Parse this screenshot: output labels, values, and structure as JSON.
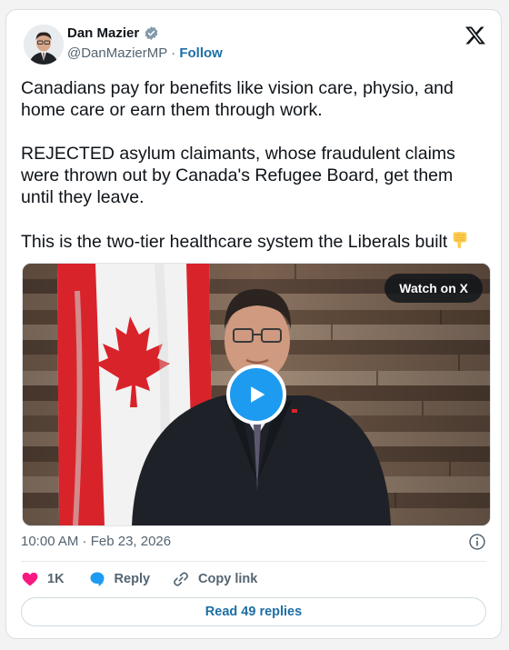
{
  "author": {
    "name": "Dan Mazier",
    "handle": "@DanMazierMP",
    "separator": " · ",
    "follow_label": "Follow",
    "verified": true,
    "verified_color": "#829aab"
  },
  "platform_logo": "x-logo-icon",
  "tweet": {
    "paragraphs": [
      "Canadians pay for benefits like vision care, physio, and home care or earn them through work.",
      "REJECTED asylum claimants, whose fraudulent claims were thrown out by Canada's Refugee Board, get them until they leave.",
      "This is the two-tier healthcare system the Liberals built"
    ],
    "trailing_emoji": "pointing-down-hand-icon"
  },
  "media": {
    "type": "video",
    "watch_label": "Watch on X",
    "play_icon": "play-icon"
  },
  "timestamp": "10:00 AM · Feb 23, 2026",
  "actions": {
    "like_count": "1K",
    "reply_label": "Reply",
    "copy_link_label": "Copy link"
  },
  "read_replies_label": "Read 49 replies",
  "colors": {
    "accent": "#1d9bf0",
    "link": "#1d6fa5",
    "like": "#f91880",
    "muted": "#536471"
  }
}
